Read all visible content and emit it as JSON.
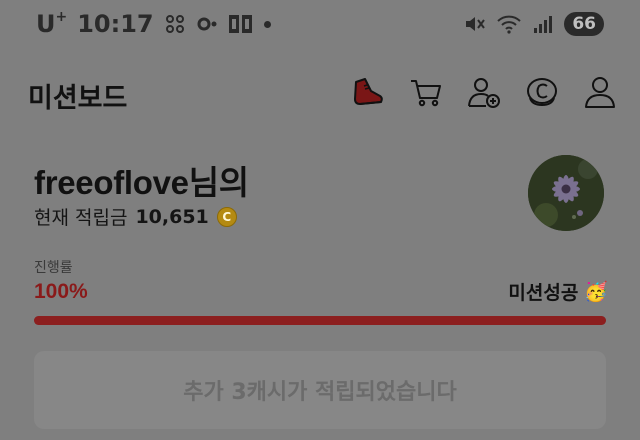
{
  "status_bar": {
    "carrier": "U",
    "carrier_sup": "+",
    "time": "10:17",
    "battery": "66"
  },
  "header": {
    "title": "미션보드",
    "icons": [
      "sneaker-icon",
      "cart-icon",
      "add-friend-icon",
      "cash-coin-icon",
      "profile-icon"
    ]
  },
  "profile": {
    "greeting": "freeoflove님의",
    "points_label": "현재 적립금",
    "points_value": "10,651",
    "coin_symbol": "C"
  },
  "progress": {
    "label": "진행률",
    "value_text": "100%",
    "fraction": 1.0,
    "status": "미션성공",
    "status_emoji": "🥳"
  },
  "cta": {
    "label": "추가 3캐시가 적립되었습니다"
  },
  "colors": {
    "accent": "#8c1f1f",
    "coin": "#b48a12"
  }
}
